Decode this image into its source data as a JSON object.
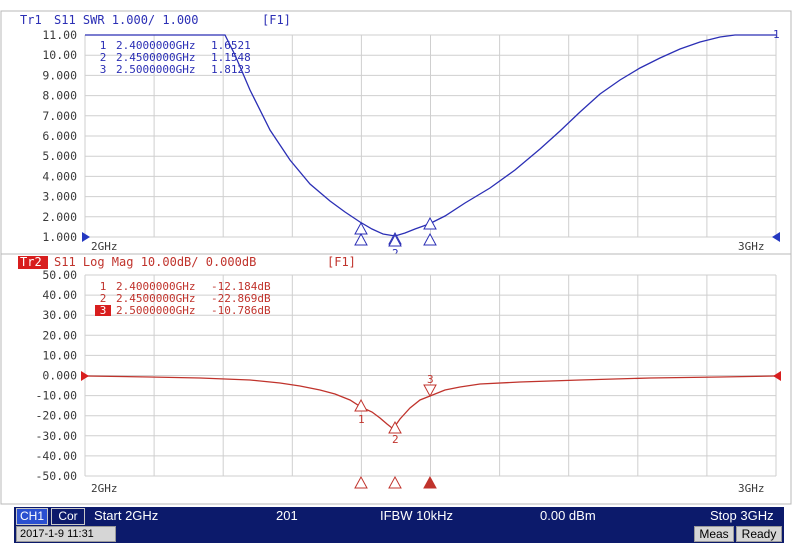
{
  "colors": {
    "trace1": "#2b2fb5",
    "trace2": "#c0332c",
    "grid": "#c9c9c9",
    "status_bg": "#0c1a6b",
    "channel_bg": "#2a4fd0",
    "marker_active_bg": "#d81e1e"
  },
  "trace1": {
    "label": "Tr1",
    "header": "S11  SWR 1.000/ 1.000",
    "function": "[F1]",
    "y_ticks": [
      "11.00",
      "10.00",
      "9.000",
      "8.000",
      "7.000",
      "6.000",
      "5.000",
      "4.000",
      "3.000",
      "2.000",
      "1.000"
    ],
    "x_start": "2GHz",
    "x_stop": "3GHz",
    "ref_label": "1",
    "markers": [
      {
        "num": "1",
        "freq": "2.4000000GHz",
        "value": "1.6521"
      },
      {
        "num": "2",
        "freq": "2.4500000GHz",
        "value": "1.1548"
      },
      {
        "num": "3",
        "freq": "2.5000000GHz",
        "value": "1.8123"
      }
    ]
  },
  "trace2": {
    "label": "Tr2",
    "header": "S11  Log Mag 10.00dB/ 0.000dB",
    "function": "[F1]",
    "y_ticks": [
      "50.00",
      "40.00",
      "30.00",
      "20.00",
      "10.00",
      "0.000",
      "-10.00",
      "-20.00",
      "-30.00",
      "-40.00",
      "-50.00"
    ],
    "x_start": "2GHz",
    "x_stop": "3GHz",
    "markers": [
      {
        "num": "1",
        "freq": "2.4000000GHz",
        "value": "-12.184dB"
      },
      {
        "num": "2",
        "freq": "2.4500000GHz",
        "value": "-22.869dB"
      },
      {
        "num": "3",
        "freq": "2.5000000GHz",
        "value": "-10.786dB"
      }
    ]
  },
  "status": {
    "channel": "CH1",
    "correction": "Cor",
    "start": "Start 2GHz",
    "points": "201",
    "ifbw": "IFBW 10kHz",
    "power": "0.00 dBm",
    "stop": "Stop 3GHz"
  },
  "info": {
    "datetime": "2017-1-9 11:31",
    "mode": "Meas",
    "state": "Ready"
  }
}
